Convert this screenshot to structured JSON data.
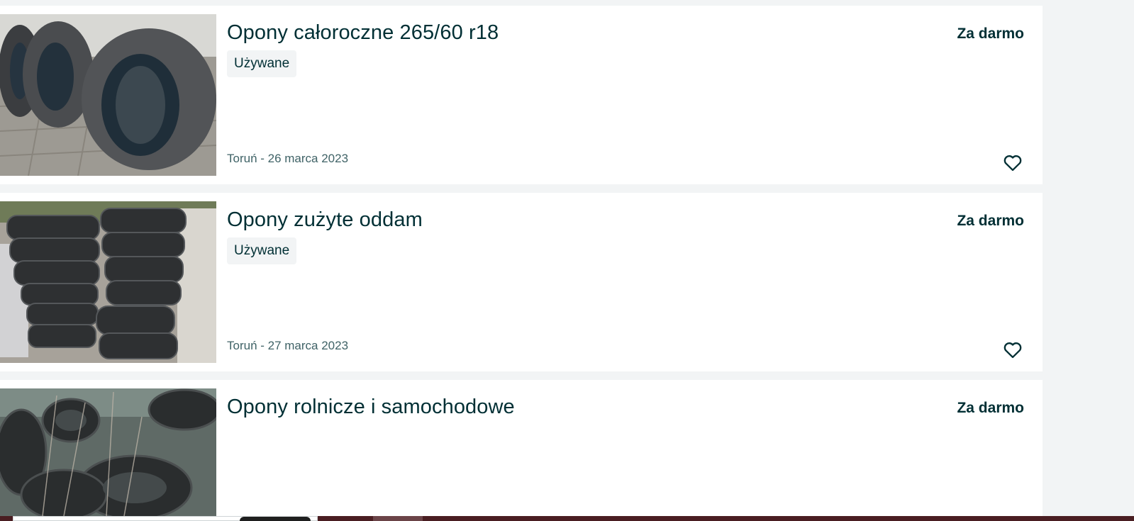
{
  "listings": [
    {
      "title": "Opony całoroczne 265/60 r18",
      "condition": "Używane",
      "price": "Za darmo",
      "location_date": "Toruń - 26 marca 2023",
      "favorite_icon": "heart-outline-icon"
    },
    {
      "title": "Opony zużyte oddam",
      "condition": "Używane",
      "price": "Za darmo",
      "location_date": "Toruń - 27 marca 2023",
      "favorite_icon": "heart-outline-icon"
    },
    {
      "title": "Opony rolnicze i samochodowe",
      "price": "Za darmo"
    }
  ],
  "colors": {
    "text": "#002f34",
    "muted_text": "#406367",
    "page_background": "#f2f4f5",
    "card_background": "#ffffff"
  }
}
